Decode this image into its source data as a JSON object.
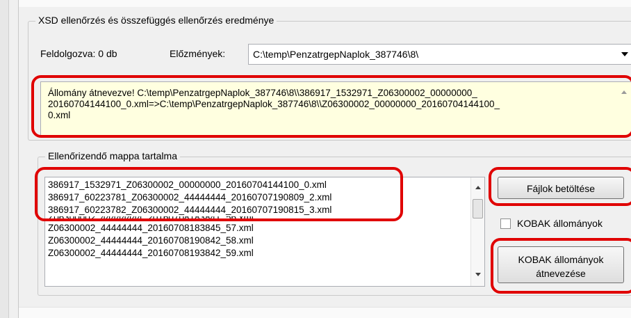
{
  "result_group": {
    "title": "XSD ellenőrzés és összefüggés ellenőrzés eredménye",
    "processed_label": "Feldolgozva: 0 db",
    "history_label": "Előzmények:",
    "history_value": "C:\\temp\\PenzatrgepNaplok_387746\\8\\",
    "message": "Állomány átnevezve! C:\\temp\\PenzatrgepNaplok_387746\\8\\\\386917_1532971_Z06300002_00000000_\n20160704144100_0.xml=>C:\\temp\\PenzatrgepNaplok_387746\\8\\\\Z06300002_00000000_20160704144100_\n0.xml"
  },
  "folder_group": {
    "title": "Ellenőrizendő mappa tartalma",
    "files": [
      "386917_1532971_Z06300002_00000000_20160704144100_0.xml",
      "386917_60223781_Z06300002_44444444_20160707190809_2.xml",
      "386917_60223782_Z06300002_44444444_20160707190815_3.xml",
      "Z06300002_44444444_20160708183841_56.xml",
      "Z06300002_44444444_20160708183845_57.xml",
      "Z06300002_44444444_20160708190842_58.xml",
      "Z06300002_44444444_20160708193842_59.xml"
    ],
    "load_button": "Fájlok betöltése",
    "kobak_checkbox": "KOBAK állományok",
    "kobak_checked": false,
    "rename_button_line1": "KOBAK állományok",
    "rename_button_line2": "átnevezése"
  },
  "colors": {
    "highlight": "#e00000",
    "message_background": "#ffffe0",
    "window_background": "#f0f0f0"
  },
  "icons": {
    "combo_arrow": "chevron-down-icon",
    "scroll_up": "arrow-up-icon",
    "scroll_down": "arrow-down-icon"
  }
}
